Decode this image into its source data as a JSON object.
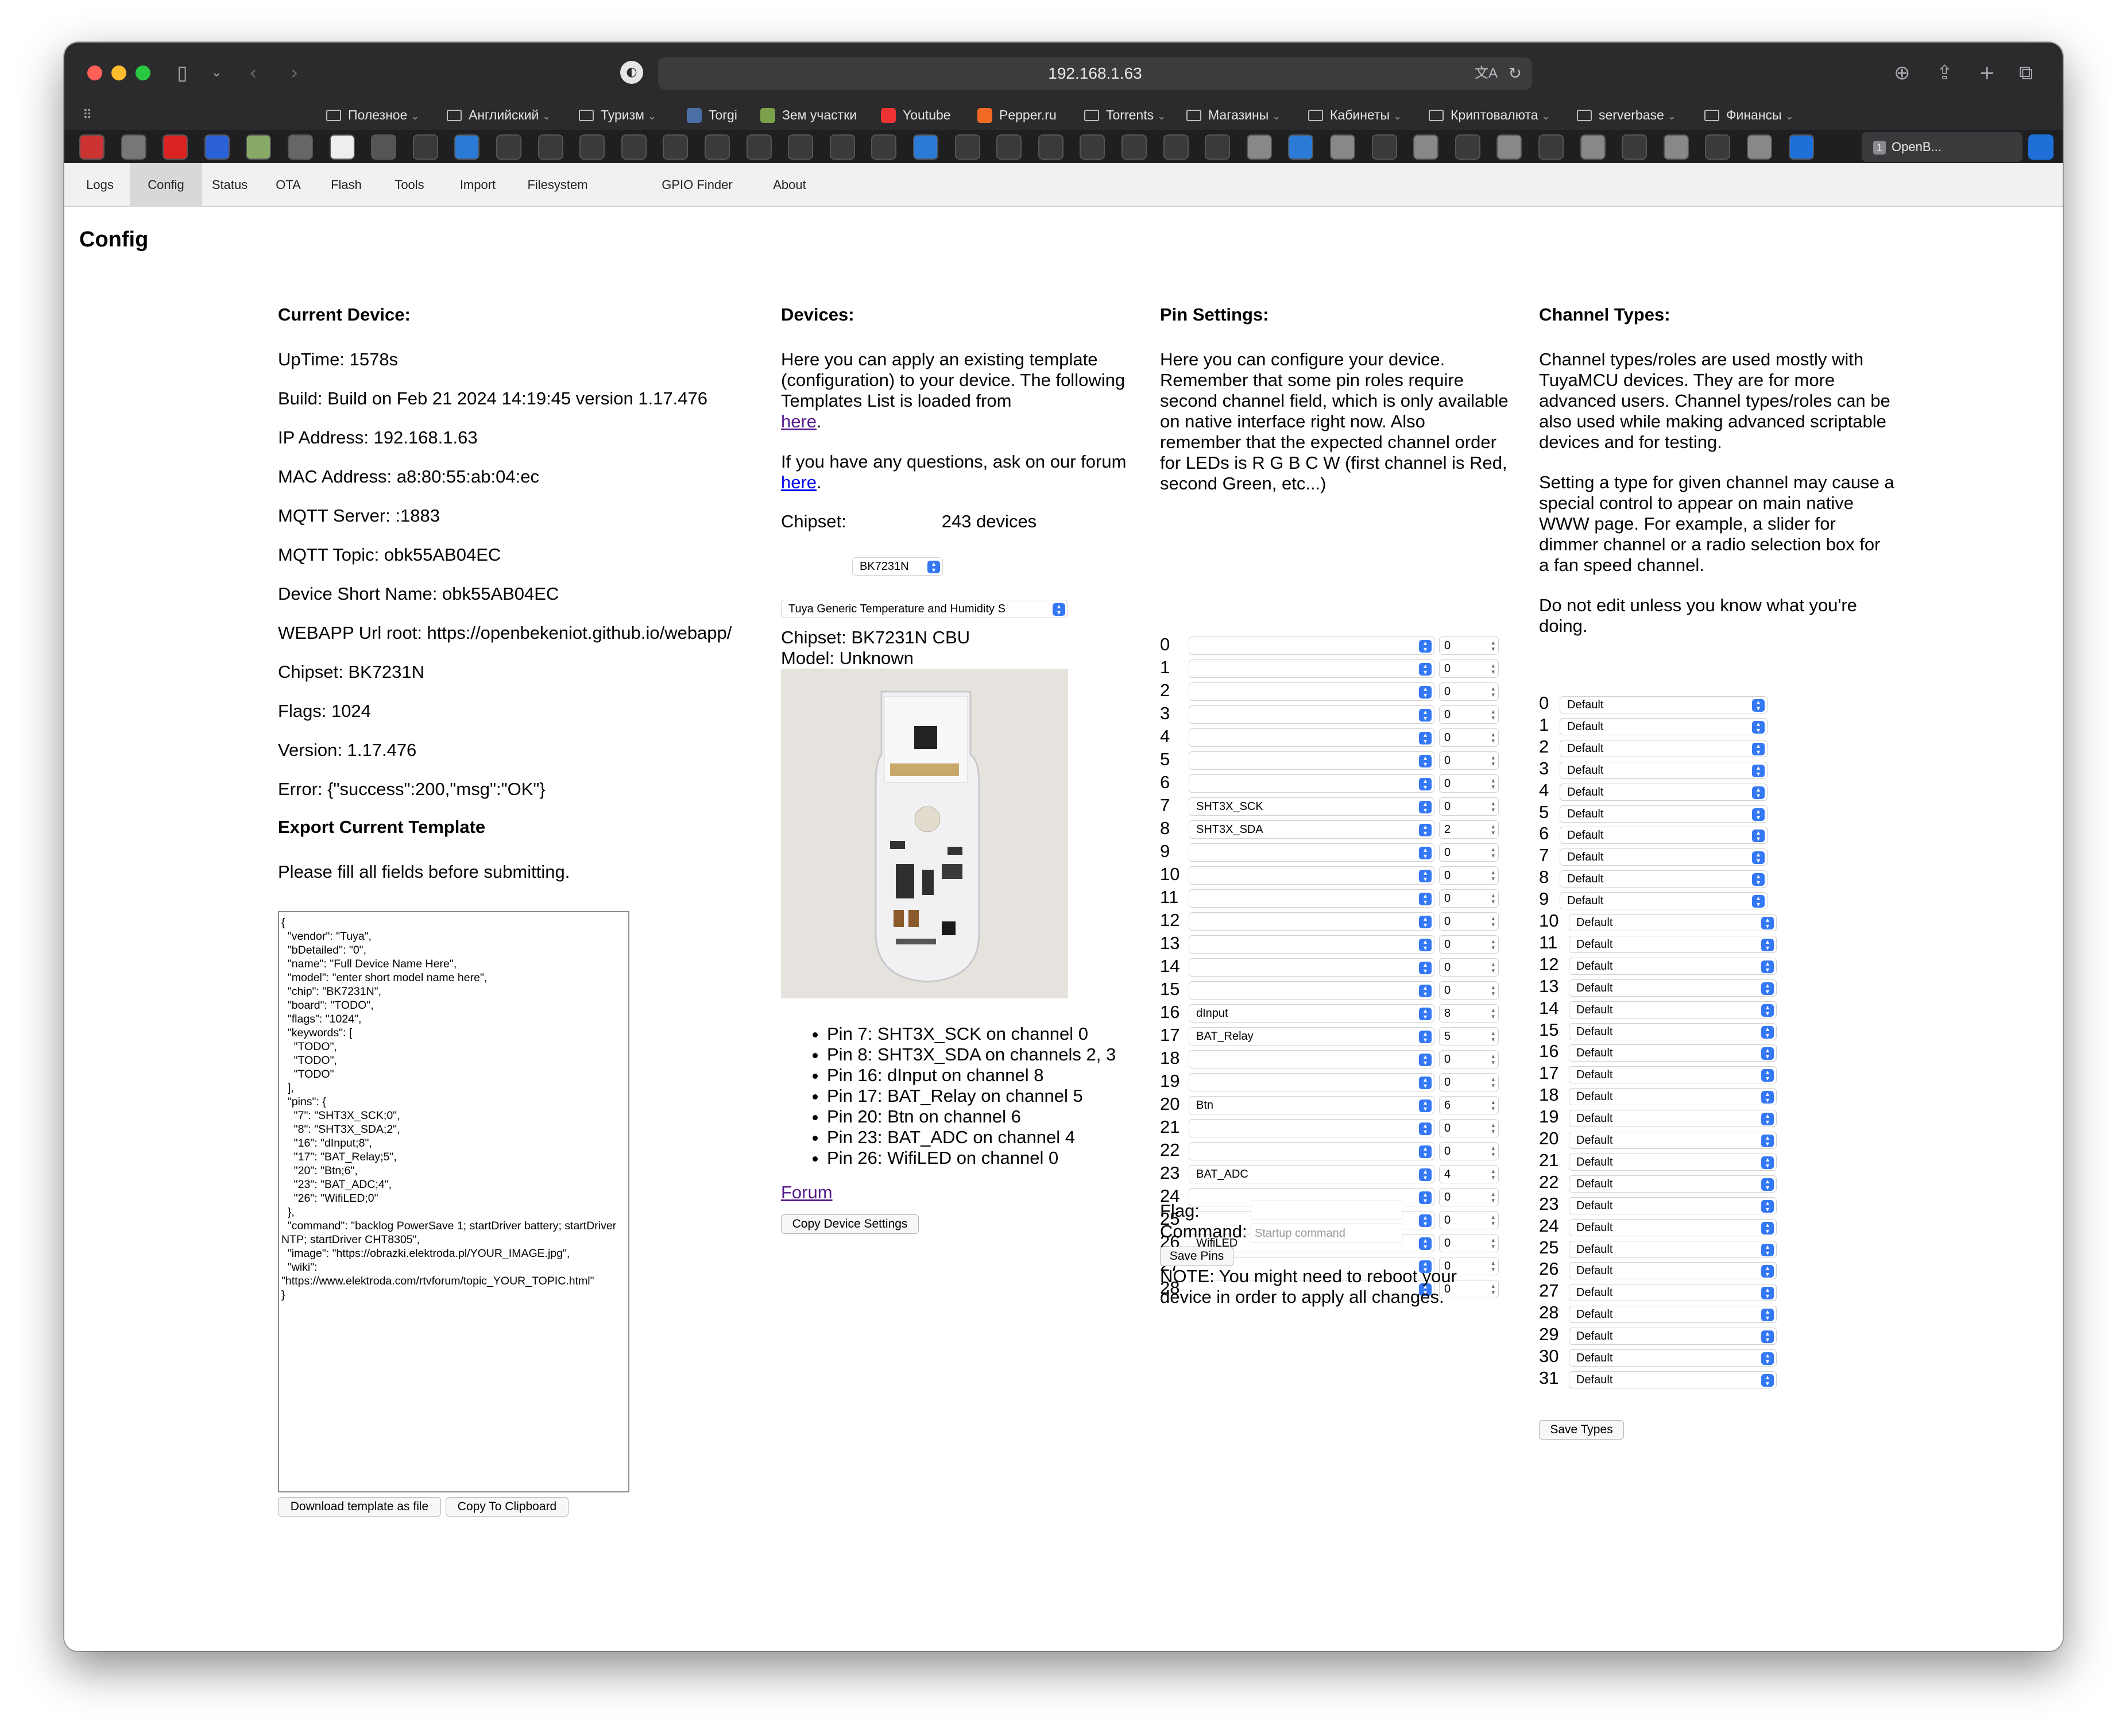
{
  "browser": {
    "url": "192.168.1.63",
    "bookmarks": [
      {
        "label": "Полезное",
        "folder": true
      },
      {
        "label": "Английский",
        "folder": true
      },
      {
        "label": "Туризм",
        "folder": true
      },
      {
        "label": "Torgi",
        "folder": false
      },
      {
        "label": "Зем участки",
        "folder": false
      },
      {
        "label": "Youtube",
        "folder": false
      },
      {
        "label": "Pepper.ru",
        "folder": false
      },
      {
        "label": "Torrents",
        "folder": true
      },
      {
        "label": "Магазины",
        "folder": true
      },
      {
        "label": "Кабинеты",
        "folder": true
      },
      {
        "label": "Криптовалюта",
        "folder": true
      },
      {
        "label": "serverbase",
        "folder": true
      },
      {
        "label": "Финансы",
        "folder": true
      }
    ],
    "active_tab": "OpenB...",
    "tab_badge": "1"
  },
  "nav": {
    "items": [
      "Logs",
      "Config",
      "Status",
      "OTA",
      "Flash",
      "Tools",
      "Import",
      "Filesystem",
      "GPIO Finder",
      "About"
    ],
    "active": "Config"
  },
  "page_title": "Config",
  "current_device": {
    "heading": "Current Device:",
    "lines": [
      "UpTime: 1578s",
      "Build: Build on Feb 21 2024 14:19:45 version 1.17.476",
      "IP Address: 192.168.1.63",
      "MAC Address: a8:80:55:ab:04:ec",
      "MQTT Server: :1883",
      "MQTT Topic: obk55AB04EC",
      "Device Short Name: obk55AB04EC",
      "WEBAPP Url root: https://openbekeniot.github.io/webapp/",
      "Chipset: BK7231N",
      "Flags: 1024",
      "Version: 1.17.476",
      "Error: {\"success\":200,\"msg\":\"OK\"}"
    ],
    "export_heading": "Export Current Template",
    "export_note": "Please fill all fields before submitting.",
    "template_text": "{\n  \"vendor\": \"Tuya\",\n  \"bDetailed\": \"0\",\n  \"name\": \"Full Device Name Here\",\n  \"model\": \"enter short model name here\",\n  \"chip\": \"BK7231N\",\n  \"board\": \"TODO\",\n  \"flags\": \"1024\",\n  \"keywords\": [\n    \"TODO\",\n    \"TODO\",\n    \"TODO\"\n  ],\n  \"pins\": {\n    \"7\": \"SHT3X_SCK;0\",\n    \"8\": \"SHT3X_SDA;2\",\n    \"16\": \"dInput;8\",\n    \"17\": \"BAT_Relay;5\",\n    \"20\": \"Btn;6\",\n    \"23\": \"BAT_ADC;4\",\n    \"26\": \"WifiLED;0\"\n  },\n  \"command\": \"backlog PowerSave 1; startDriver battery; startDriver NTP; startDriver CHT8305\",\n  \"image\": \"https://obrazki.elektroda.pl/YOUR_IMAGE.jpg\",\n  \"wiki\": \"https://www.elektroda.com/rtvforum/topic_YOUR_TOPIC.html\"\n}",
    "download_button": "Download template as file",
    "copy_button": "Copy To Clipboard"
  },
  "devices": {
    "heading": "Devices:",
    "intro": "Here you can apply an existing template (configuration) to your device. The following Templates List is loaded from",
    "intro_link": "here",
    "question": "If you have any questions, ask on our forum",
    "question_link": "here",
    "chipset_label": "Chipset:",
    "chipset_value": "BK7231N",
    "device_count": "243 devices",
    "template_select": "Tuya Generic Temperature and Humidity S",
    "chipset_info": "Chipset: BK7231N CBU",
    "model_info": "Model: Unknown",
    "pins_list": [
      "Pin 7: SHT3X_SCK on channel 0",
      "Pin 8: SHT3X_SDA on channels 2, 3",
      "Pin 16: dInput on channel 8",
      "Pin 17: BAT_Relay on channel 5",
      "Pin 20: Btn on channel 6",
      "Pin 23: BAT_ADC on channel 4",
      "Pin 26: WifiLED on channel 0"
    ],
    "forum_link": "Forum",
    "copy_settings_button": "Copy Device Settings"
  },
  "pin_settings": {
    "heading": "Pin Settings:",
    "intro": "Here you can configure your device. Remember that some pin roles require second channel field, which is only available on native interface right now. Also remember that the expected channel order for LEDs is R G B C W (first channel is Red, second Green, etc...)",
    "pins": [
      {
        "n": "0",
        "role": "",
        "ch": "0"
      },
      {
        "n": "1",
        "role": "",
        "ch": "0"
      },
      {
        "n": "2",
        "role": "",
        "ch": "0"
      },
      {
        "n": "3",
        "role": "",
        "ch": "0"
      },
      {
        "n": "4",
        "role": "",
        "ch": "0"
      },
      {
        "n": "5",
        "role": "",
        "ch": "0"
      },
      {
        "n": "6",
        "role": "",
        "ch": "0"
      },
      {
        "n": "7",
        "role": "SHT3X_SCK",
        "ch": "0"
      },
      {
        "n": "8",
        "role": "SHT3X_SDA",
        "ch": "2"
      },
      {
        "n": "9",
        "role": "",
        "ch": "0"
      },
      {
        "n": "10",
        "role": "",
        "ch": "0"
      },
      {
        "n": "11",
        "role": "",
        "ch": "0"
      },
      {
        "n": "12",
        "role": "",
        "ch": "0"
      },
      {
        "n": "13",
        "role": "",
        "ch": "0"
      },
      {
        "n": "14",
        "role": "",
        "ch": "0"
      },
      {
        "n": "15",
        "role": "",
        "ch": "0"
      },
      {
        "n": "16",
        "role": "dInput",
        "ch": "8"
      },
      {
        "n": "17",
        "role": "BAT_Relay",
        "ch": "5"
      },
      {
        "n": "18",
        "role": "",
        "ch": "0"
      },
      {
        "n": "19",
        "role": "",
        "ch": "0"
      },
      {
        "n": "20",
        "role": "Btn",
        "ch": "6"
      },
      {
        "n": "21",
        "role": "",
        "ch": "0"
      },
      {
        "n": "22",
        "role": "",
        "ch": "0"
      },
      {
        "n": "23",
        "role": "BAT_ADC",
        "ch": "4"
      },
      {
        "n": "24",
        "role": "",
        "ch": "0"
      },
      {
        "n": "25",
        "role": "",
        "ch": "0"
      },
      {
        "n": "26",
        "role": "WifiLED",
        "ch": "0"
      },
      {
        "n": "27",
        "role": "",
        "ch": "0"
      },
      {
        "n": "28",
        "role": "",
        "ch": "0"
      }
    ],
    "flag_label": "Flag:",
    "command_label": "Command:",
    "command_placeholder": "Startup command",
    "save_button": "Save Pins",
    "note": "NOTE: You might need to reboot your device in order to apply all changes."
  },
  "channel_types": {
    "heading": "Channel Types:",
    "intro": "Channel types/roles are used mostly with TuyaMCU devices. They are for more advanced users. Channel types/roles can be also used while making advanced scriptable devices and for testing.",
    "intro2": "Setting a type for given channel may cause a special control to appear on main native WWW page. For example, a slider for dimmer channel or a radio selection box for a fan speed channel.",
    "intro3": "Do not edit unless you know what you're doing.",
    "channels": [
      "0",
      "1",
      "2",
      "3",
      "4",
      "5",
      "6",
      "7",
      "8",
      "9",
      "10",
      "11",
      "12",
      "13",
      "14",
      "15",
      "16",
      "17",
      "18",
      "19",
      "20",
      "21",
      "22",
      "23",
      "24",
      "25",
      "26",
      "27",
      "28",
      "29",
      "30",
      "31"
    ],
    "default_value": "Default",
    "save_button": "Save Types"
  },
  "colors": {
    "chrome": "#2b2b2d",
    "select_arrow": "#3478f6",
    "link": "#0000ee",
    "visited_link": "#551a8b"
  }
}
